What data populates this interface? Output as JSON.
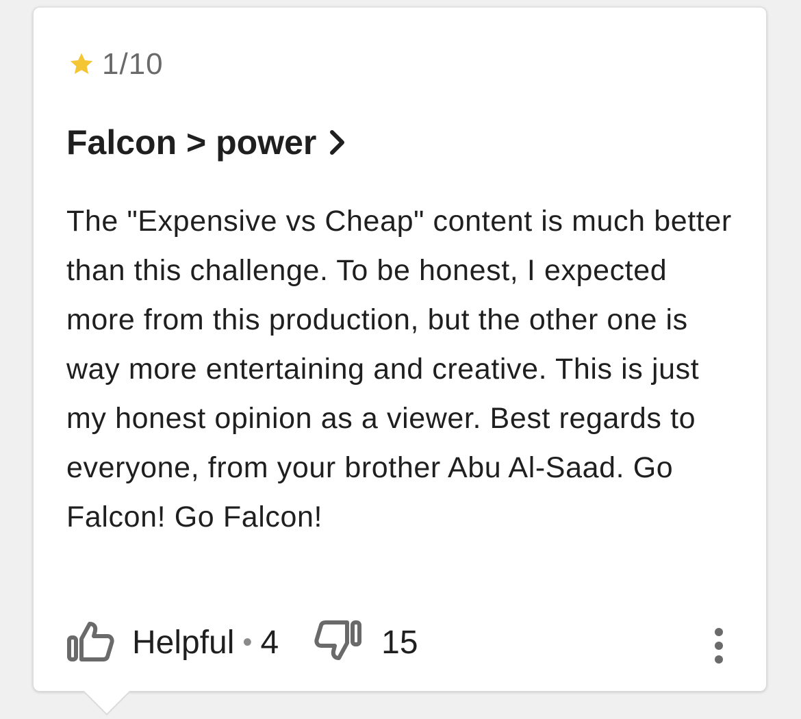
{
  "review": {
    "rating_text": "1/10",
    "title": "Falcon > power",
    "body": "The \"Expensive vs Cheap\" content is much better than this challenge. To be honest, I expected more from this production, but the other one is way more entertaining and creative. This is just my honest opinion as a viewer. Best regards to everyone, from your brother Abu Al-Saad. Go Falcon! Go Falcon!",
    "helpful_label": "Helpful",
    "separator": "•",
    "helpful_count": "4",
    "dislike_count": "15"
  },
  "icons": {
    "star": "star-icon",
    "chevron": "chevron-right-icon",
    "thumbs_up": "thumbs-up-icon",
    "thumbs_down": "thumbs-down-icon",
    "more": "more-vertical-icon"
  },
  "colors": {
    "star": "#f4c534",
    "text": "#1f1f1f",
    "muted": "#6a6a6a"
  }
}
